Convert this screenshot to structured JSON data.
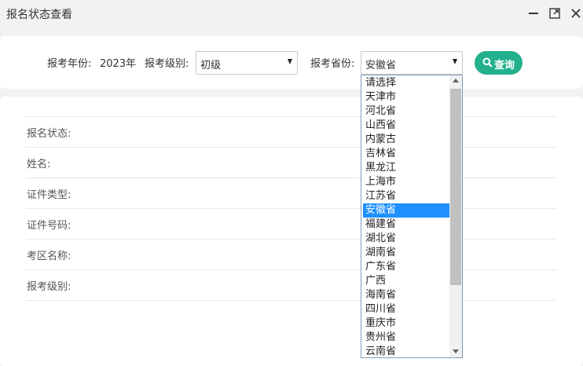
{
  "window": {
    "title": "报名状态查看"
  },
  "search": {
    "year_label": "报考年份:",
    "year_value": "2023年",
    "level_label": "报考级别:",
    "level_value": "初级",
    "province_label": "报考省份:",
    "province_value": "安徽省",
    "query_label": "查询"
  },
  "dropdown": {
    "options": [
      "请选择",
      "天津市",
      "河北省",
      "山西省",
      "内蒙古",
      "吉林省",
      "黑龙江",
      "上海市",
      "江苏省",
      "安徽省",
      "福建省",
      "湖北省",
      "湖南省",
      "广东省",
      "广西",
      "海南省",
      "四川省",
      "重庆市",
      "贵州省",
      "云南省"
    ],
    "selected_index": 9,
    "selected_color": "#1e90ff"
  },
  "result": {
    "labels": [
      "报名状态:",
      "姓名:",
      "证件类型:",
      "证件号码:",
      "考区名称:",
      "报考级别:"
    ]
  },
  "colors": {
    "accent": "#23b08d"
  }
}
